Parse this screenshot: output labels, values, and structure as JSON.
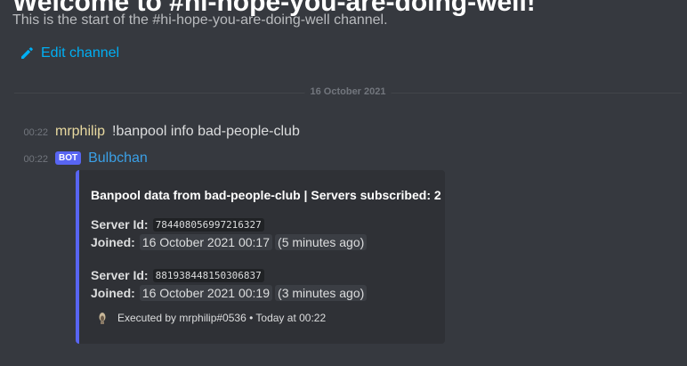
{
  "channel": {
    "header": "Welcome to #hi-hope-you-are-doing-well!",
    "description": "This is the start of the #hi-hope-you-are-doing-well channel.",
    "edit_label": "Edit channel"
  },
  "divider": {
    "date": "16 October 2021"
  },
  "messages": [
    {
      "time": "00:22",
      "author": "mrphilip",
      "author_color": "#e8d9a0",
      "text": "!banpool info bad-people-club"
    },
    {
      "time": "00:22",
      "badge": "BOT",
      "author": "Bulbchan",
      "author_color": "#3ba0e6"
    }
  ],
  "embed": {
    "accent_color": "#5865f2",
    "title": "Banpool data from bad-people-club | Servers subscribed: 2",
    "servers": [
      {
        "id_label": "Server Id:",
        "id": "784408056997216327",
        "joined_label": "Joined:",
        "joined": "16 October 2021 00:17",
        "relative": "5 minutes ago"
      },
      {
        "id_label": "Server Id:",
        "id": "881938448150306837",
        "joined_label": "Joined:",
        "joined": "16 October 2021 00:19",
        "relative": "3 minutes ago"
      }
    ],
    "footer": "Executed by mrphilip#0536 • Today at 00:22",
    "footer_icon": "user-avatar-icon"
  }
}
